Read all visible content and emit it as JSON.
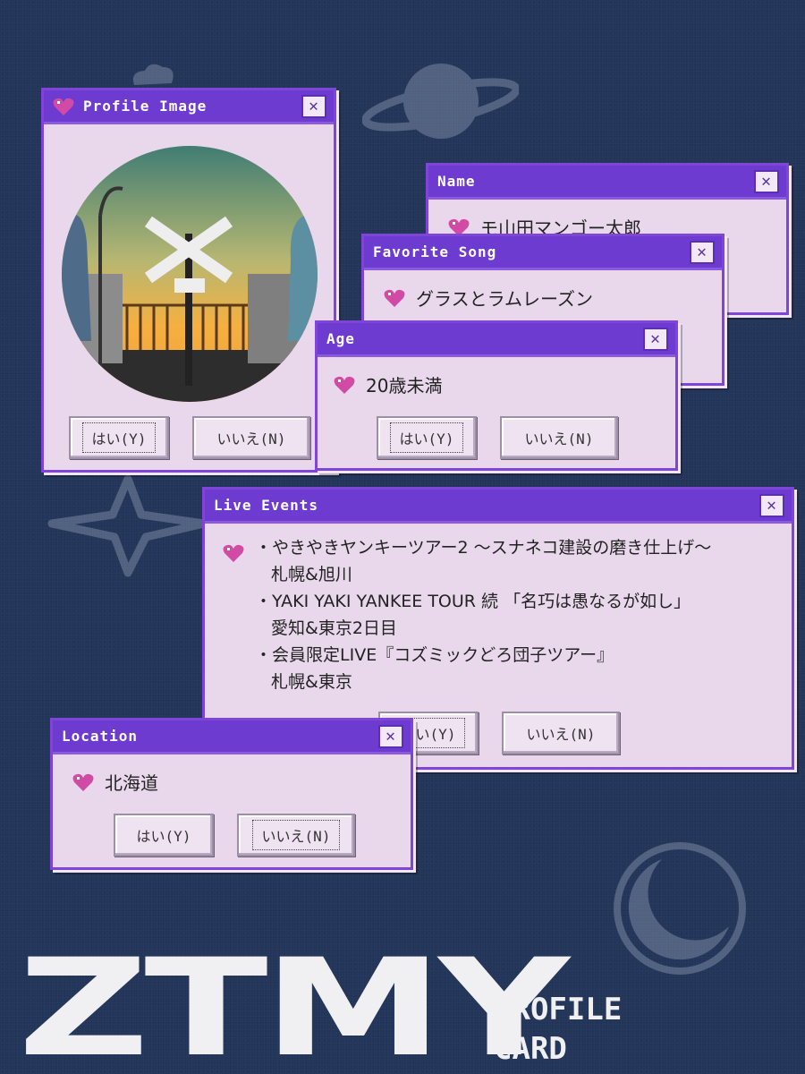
{
  "windows": {
    "profile_image": {
      "title": "Profile Image",
      "yes_label": "はい(Y)",
      "no_label": "いいえ(N)"
    },
    "name": {
      "title": "Name",
      "value": "モ山田マンゴー太郎"
    },
    "favorite_song": {
      "title": "Favorite Song",
      "value": "グラスとラムレーズン"
    },
    "age": {
      "title": "Age",
      "value": "20歳未満",
      "yes_label": "はい(Y)",
      "no_label": "いいえ(N)"
    },
    "live_events": {
      "title": "Live Events",
      "items": [
        {
          "main": "やきやきヤンキーツアー2 ～スナネコ建設の磨き仕上げ～",
          "sub": "札幌&旭川"
        },
        {
          "main": "YAKI YAKI YANKEE TOUR 続 「名巧は愚なるが如し」",
          "sub": "愛知&東京2日目"
        },
        {
          "main": "会員限定LIVE『コズミックどろ団子ツアー』",
          "sub": "札幌&東京"
        }
      ],
      "yes_label": "はい(Y)",
      "no_label": "いいえ(N)"
    },
    "location": {
      "title": "Location",
      "value": "北海道",
      "yes_label": "はい(Y)",
      "no_label": "いいえ(N)"
    }
  },
  "brand": {
    "logo": "ZTMY",
    "subtitle_line1": "PROFILE",
    "subtitle_line2": "CARD"
  },
  "icons": {
    "heart": "heart-icon",
    "close": "close-icon",
    "planet": "planet-icon",
    "moon": "moon-icon"
  },
  "colors": {
    "background": "#23365a",
    "titlebar": "#6e3bd1",
    "window_body": "#e9d7ec",
    "heart": "#d14aa5"
  }
}
